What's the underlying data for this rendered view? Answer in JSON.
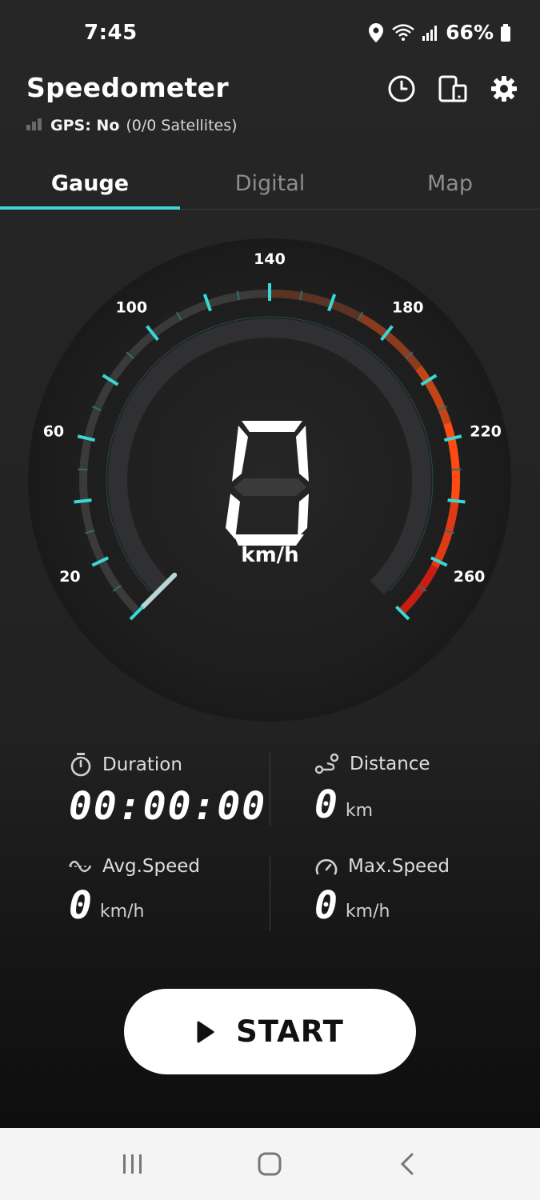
{
  "status": {
    "time": "7:45",
    "battery": "66%"
  },
  "header": {
    "title": "Speedometer",
    "gps_label": "GPS: No",
    "gps_detail": "(0/0 Satellites)"
  },
  "tabs": [
    {
      "label": "Gauge",
      "active": true
    },
    {
      "label": "Digital",
      "active": false
    },
    {
      "label": "Map",
      "active": false
    }
  ],
  "gauge": {
    "speed": "0",
    "unit": "km/h",
    "tick_labels": [
      "20",
      "60",
      "100",
      "140",
      "180",
      "220",
      "260"
    ],
    "accent_color": "#37d8d6",
    "hot_color": "#ff4a12"
  },
  "stats": {
    "duration": {
      "label": "Duration",
      "value": "00:00:00"
    },
    "distance": {
      "label": "Distance",
      "value": "0",
      "unit": "km"
    },
    "avg_speed": {
      "label": "Avg.Speed",
      "value": "0",
      "unit": "km/h"
    },
    "max_speed": {
      "label": "Max.Speed",
      "value": "0",
      "unit": "km/h"
    }
  },
  "start_button": {
    "label": "START"
  }
}
